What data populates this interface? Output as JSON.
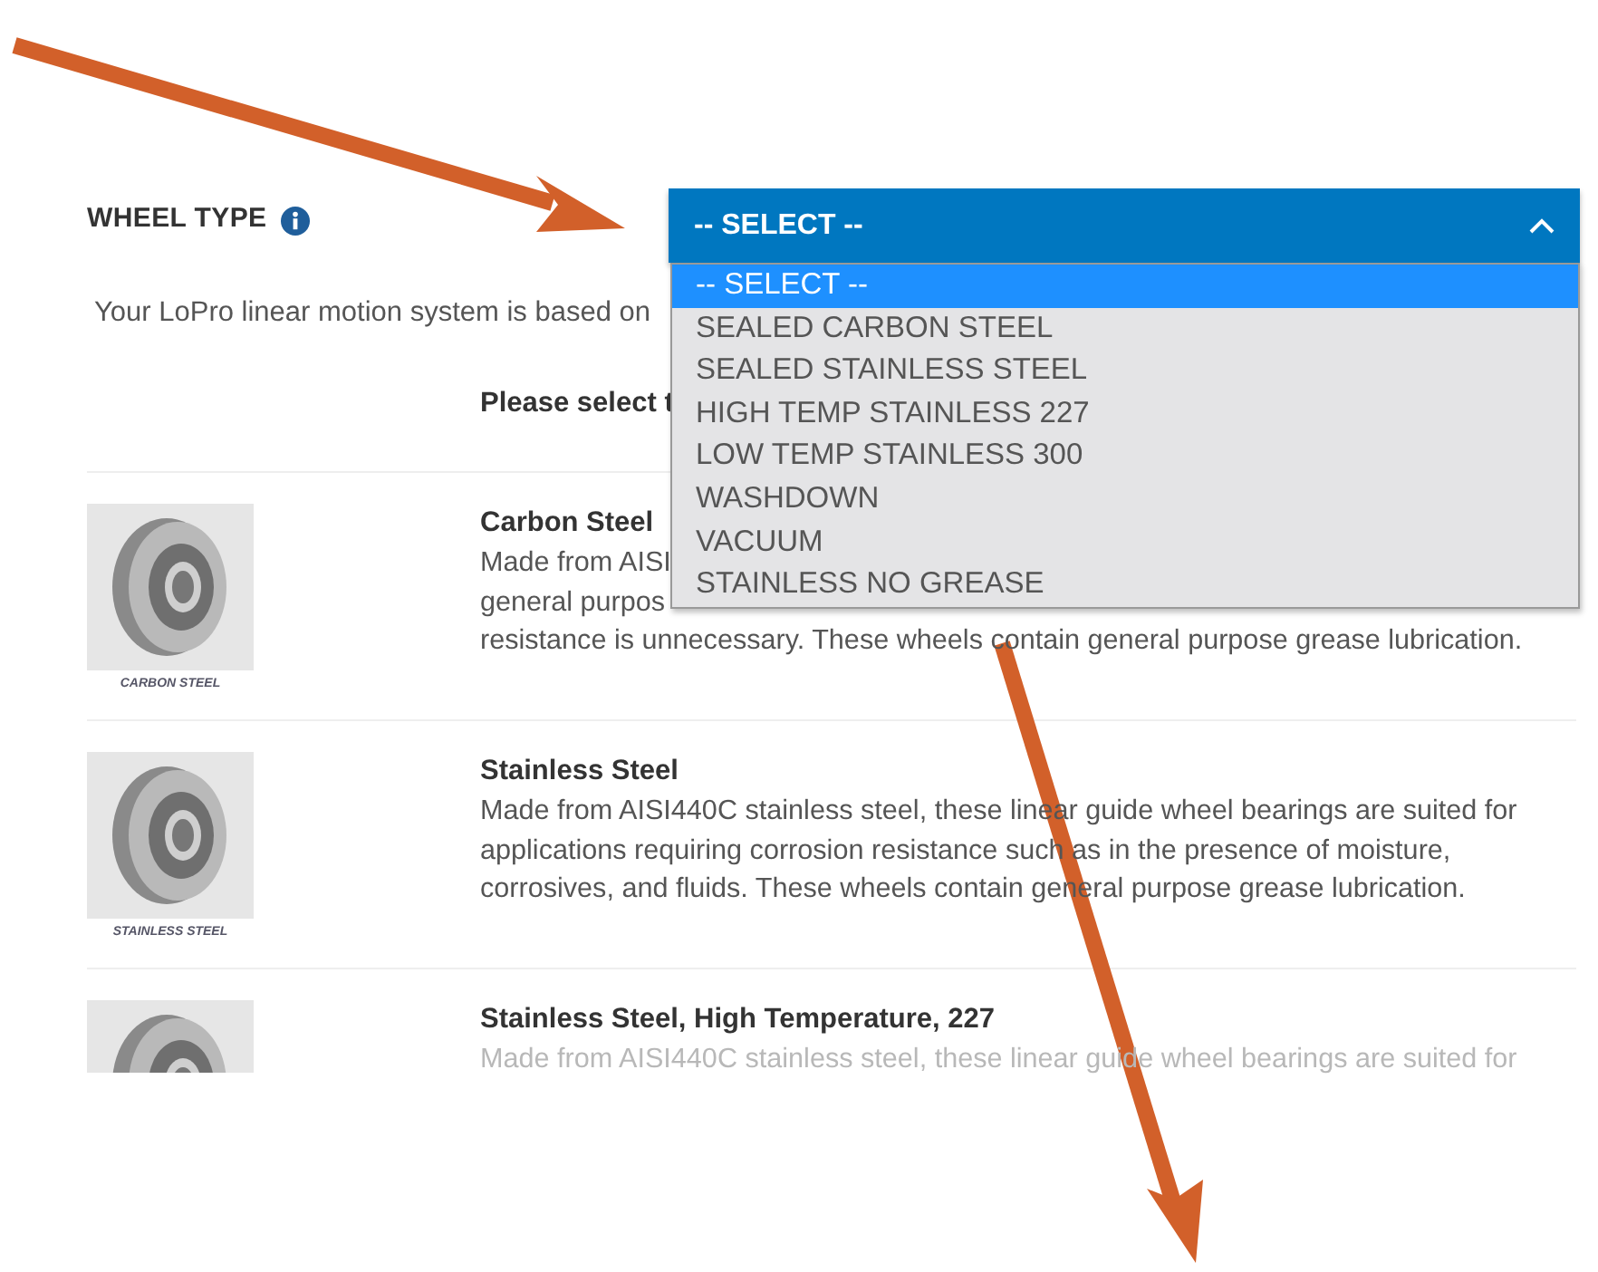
{
  "field": {
    "label": "WHEEL TYPE",
    "select": {
      "value": "-- SELECT --",
      "expanded": true,
      "options": [
        {
          "label": "-- SELECT --",
          "selected": true
        },
        {
          "label": "SEALED CARBON STEEL",
          "selected": false
        },
        {
          "label": "SEALED STAINLESS STEEL",
          "selected": false
        },
        {
          "label": "HIGH TEMP STAINLESS 227",
          "selected": false
        },
        {
          "label": "LOW TEMP STAINLESS 300",
          "selected": false
        },
        {
          "label": "WASHDOWN",
          "selected": false
        },
        {
          "label": "VACUUM",
          "selected": false
        },
        {
          "label": "STAINLESS NO GREASE",
          "selected": false
        }
      ]
    }
  },
  "intro": "Your LoPro linear motion system is based on",
  "prompt": "Please select t",
  "wheels": [
    {
      "title": "Carbon Steel",
      "caption": "CARBON STEEL",
      "lines": [
        "Made from AISI",
        "general purpos",
        "resistance is unnecessary. These wheels contain general purpose grease lubrication."
      ]
    },
    {
      "title": "Stainless Steel",
      "caption": "STAINLESS STEEL",
      "lines": [
        "Made from AISI440C stainless steel, these linear guide wheel bearings are suited for",
        "applications requiring corrosion resistance such as in the presence of moisture,",
        "corrosives, and fluids. These wheels contain general purpose grease lubrication."
      ]
    },
    {
      "title": "Stainless Steel, High Temperature, 227",
      "lines": [
        "Made from AISI440C stainless steel, these linear guide wheel bearings are suited for"
      ]
    }
  ]
}
